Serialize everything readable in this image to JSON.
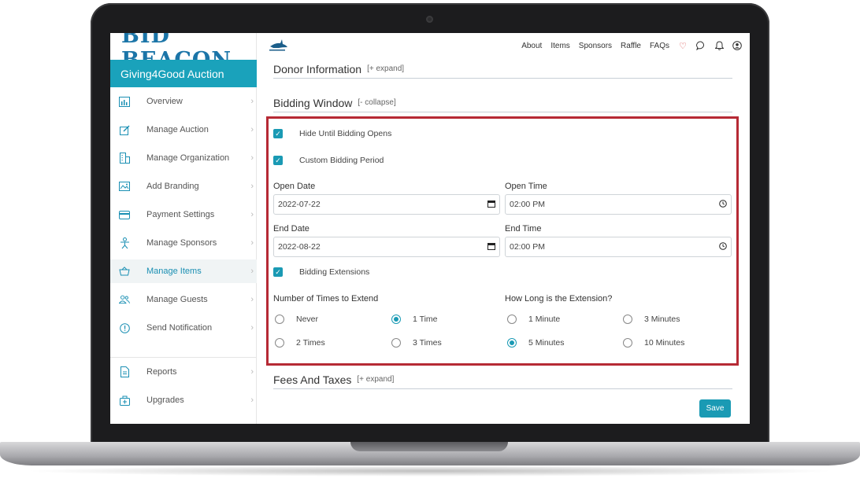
{
  "brand": {
    "logo_text": "BID BEACON",
    "accent": "#1aa2bb",
    "highlight": "#b62a35"
  },
  "sidebar": {
    "org_name": "Giving4Good Auction",
    "items": [
      {
        "label": "Overview",
        "icon": "bar-chart-icon"
      },
      {
        "label": "Manage Auction",
        "icon": "edit-icon"
      },
      {
        "label": "Manage Organization",
        "icon": "building-icon"
      },
      {
        "label": "Add Branding",
        "icon": "image-icon"
      },
      {
        "label": "Payment Settings",
        "icon": "credit-card-icon"
      },
      {
        "label": "Manage Sponsors",
        "icon": "person-icon"
      },
      {
        "label": "Manage Items",
        "icon": "basket-icon",
        "active": true
      },
      {
        "label": "Manage Guests",
        "icon": "users-icon"
      },
      {
        "label": "Send Notification",
        "icon": "alert-icon"
      },
      {
        "label": "Reports",
        "icon": "document-icon"
      },
      {
        "label": "Upgrades",
        "icon": "upgrade-icon"
      }
    ]
  },
  "topnav": {
    "links": [
      "About",
      "Items",
      "Sponsors",
      "Raffle",
      "FAQs"
    ],
    "icons": [
      "heart-icon",
      "chat-icon",
      "bell-icon",
      "account-icon"
    ]
  },
  "sections": {
    "donor": {
      "title": "Donor Information",
      "toggle": "[+ expand]"
    },
    "bidding": {
      "title": "Bidding Window",
      "toggle": "[- collapse]"
    },
    "fees": {
      "title": "Fees And Taxes",
      "toggle": "[+ expand]"
    }
  },
  "bidding": {
    "hide_until_opens": {
      "label": "Hide Until Bidding Opens",
      "checked": true
    },
    "custom_period": {
      "label": "Custom Bidding Period",
      "checked": true
    },
    "open_date": {
      "label": "Open Date",
      "value": "2022-07-22"
    },
    "open_time": {
      "label": "Open Time",
      "value": "02:00 PM"
    },
    "end_date": {
      "label": "End Date",
      "value": "2022-08-22"
    },
    "end_time": {
      "label": "End Time",
      "value": "02:00 PM"
    },
    "extensions": {
      "label": "Bidding Extensions",
      "checked": true
    },
    "times_to_extend": {
      "label": "Number of Times to Extend",
      "options": [
        "Never",
        "1 Time",
        "2 Times",
        "3 Times"
      ],
      "selected": "1 Time"
    },
    "extension_length": {
      "label": "How Long is the Extension?",
      "options": [
        "1 Minute",
        "3 Minutes",
        "5 Minutes",
        "10 Minutes"
      ],
      "selected": "5 Minutes"
    }
  },
  "actions": {
    "save_label": "Save"
  }
}
